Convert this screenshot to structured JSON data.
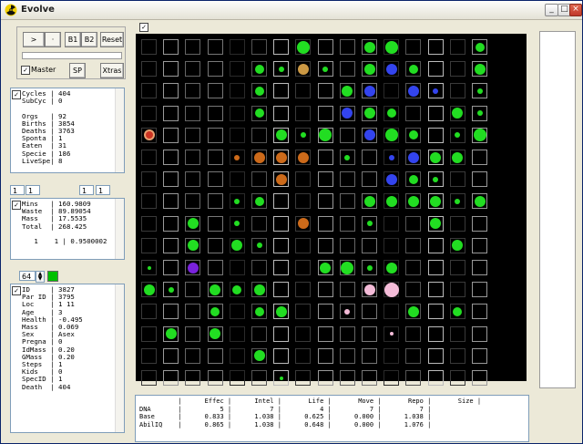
{
  "window": {
    "title": "Evolve"
  },
  "toolbar": {
    "play": ">",
    "step": "·",
    "b1": "B1",
    "b2": "B2",
    "reset": "Reset",
    "master": "Master",
    "master_checked": "✓",
    "sp": "SP",
    "xtras": "Xtras"
  },
  "grid_checkbox": "✓",
  "stats": {
    "checked": "✓",
    "lines": [
      "Cycles | 404",
      "SubCyc | 0",
      "",
      "Orgs   | 92",
      "Births | 3854",
      "Deaths | 3763",
      "Sponta | 1",
      "Eaten  | 31",
      "Specie | 186",
      "LiveSpe| 8"
    ]
  },
  "coords": {
    "x": "1",
    "y": "1",
    "x2": "1",
    "y2": "1"
  },
  "mins": {
    "checked": "✓",
    "lines": [
      "Mins   | 160.9809",
      "Waste  | 89.89054",
      "Mass   | 17.5535",
      "Total  | 268.425",
      "",
      "   1    1 | 0.9500002"
    ]
  },
  "spinner": {
    "value": "64",
    "color": "#00c000"
  },
  "organism": {
    "checked": "✓",
    "lines": [
      "ID     | 3827",
      "Par ID | 3795",
      "Loc    | 1 11",
      "Age    | 3",
      "Health | -0.495",
      "Mass   | 0.069",
      "Sex    | Asex",
      "Pregna | 0",
      "IdMass | 0.20",
      "GMass  | 0.20",
      "Steps  | 1",
      "Kids   | 0",
      "SpecID | 1",
      "Death  | 404"
    ]
  },
  "table": {
    "lines": [
      "          |      Effec |      Intel |       Life |       Move |       Repo |       Size |",
      "DNA       |          5 |          7 |          4 |          7 |          7 |",
      "Base      |      0.833 |      1.038 |      0.625 |      0.000 |      1.038 |",
      "AbilIQ    |      0.865 |      1.038 |      0.648 |      0.000 |      1.076 |"
    ]
  },
  "colors": {
    "food": "#22dd22",
    "predator": "#3344ee",
    "egg": "#cc6a1a",
    "pink": "#f4bcd8",
    "purple": "#7a22dd",
    "tan": "#cc9944",
    "red": "#cc3322"
  },
  "grid_data": {
    "cols": 16,
    "rows": 16,
    "blobs": [
      [
        7,
        0,
        "food",
        14
      ],
      [
        10,
        0,
        "food",
        12
      ],
      [
        11,
        0,
        "food",
        14
      ],
      [
        15,
        0,
        "food",
        10
      ],
      [
        5,
        1,
        "food",
        10
      ],
      [
        6,
        1,
        "food",
        6
      ],
      [
        7,
        1,
        "tan",
        12
      ],
      [
        8,
        1,
        "food",
        6
      ],
      [
        10,
        1,
        "food",
        12
      ],
      [
        11,
        1,
        "predator",
        12
      ],
      [
        12,
        1,
        "food",
        10
      ],
      [
        15,
        1,
        "food",
        12
      ],
      [
        5,
        2,
        "food",
        10
      ],
      [
        9,
        2,
        "food",
        12
      ],
      [
        10,
        2,
        "predator",
        12
      ],
      [
        12,
        2,
        "predator",
        12
      ],
      [
        13,
        2,
        "predator",
        6
      ],
      [
        15,
        2,
        "food",
        6
      ],
      [
        5,
        3,
        "food",
        10
      ],
      [
        9,
        3,
        "predator",
        12
      ],
      [
        10,
        3,
        "food",
        12
      ],
      [
        11,
        3,
        "food",
        10
      ],
      [
        14,
        3,
        "food",
        12
      ],
      [
        15,
        3,
        "food",
        6
      ],
      [
        0,
        4,
        "red",
        8
      ],
      [
        6,
        4,
        "food",
        12
      ],
      [
        7,
        4,
        "food",
        6
      ],
      [
        8,
        4,
        "food",
        14
      ],
      [
        10,
        4,
        "predator",
        12
      ],
      [
        11,
        4,
        "food",
        14
      ],
      [
        12,
        4,
        "food",
        10
      ],
      [
        14,
        4,
        "food",
        6
      ],
      [
        15,
        4,
        "food",
        14
      ],
      [
        4,
        5,
        "egg",
        6
      ],
      [
        5,
        5,
        "egg",
        12
      ],
      [
        6,
        5,
        "egg",
        12
      ],
      [
        7,
        5,
        "egg",
        12
      ],
      [
        9,
        5,
        "food",
        6
      ],
      [
        11,
        5,
        "predator",
        6
      ],
      [
        12,
        5,
        "predator",
        12
      ],
      [
        13,
        5,
        "food",
        12
      ],
      [
        14,
        5,
        "food",
        12
      ],
      [
        6,
        6,
        "egg",
        12
      ],
      [
        11,
        6,
        "predator",
        12
      ],
      [
        12,
        6,
        "food",
        10
      ],
      [
        13,
        6,
        "food",
        6
      ],
      [
        4,
        7,
        "food",
        6
      ],
      [
        5,
        7,
        "food",
        10
      ],
      [
        10,
        7,
        "food",
        12
      ],
      [
        11,
        7,
        "food",
        12
      ],
      [
        12,
        7,
        "food",
        12
      ],
      [
        13,
        7,
        "food",
        12
      ],
      [
        14,
        7,
        "food",
        6
      ],
      [
        15,
        7,
        "food",
        12
      ],
      [
        2,
        8,
        "food",
        12
      ],
      [
        4,
        8,
        "food",
        6
      ],
      [
        7,
        8,
        "egg",
        12
      ],
      [
        10,
        8,
        "food",
        6
      ],
      [
        13,
        8,
        "food",
        12
      ],
      [
        2,
        9,
        "food",
        12
      ],
      [
        4,
        9,
        "food",
        12
      ],
      [
        5,
        9,
        "food",
        6
      ],
      [
        14,
        9,
        "food",
        12
      ],
      [
        0,
        10,
        "food",
        4
      ],
      [
        2,
        10,
        "purple",
        12
      ],
      [
        8,
        10,
        "food",
        12
      ],
      [
        9,
        10,
        "food",
        14
      ],
      [
        10,
        10,
        "food",
        6
      ],
      [
        11,
        10,
        "food",
        12
      ],
      [
        0,
        11,
        "food",
        12
      ],
      [
        1,
        11,
        "food",
        6
      ],
      [
        3,
        11,
        "food",
        12
      ],
      [
        4,
        11,
        "food",
        10
      ],
      [
        5,
        11,
        "food",
        12
      ],
      [
        10,
        11,
        "pink",
        12
      ],
      [
        11,
        11,
        "pink",
        16
      ],
      [
        3,
        12,
        "food",
        10
      ],
      [
        5,
        12,
        "food",
        10
      ],
      [
        6,
        12,
        "food",
        12
      ],
      [
        9,
        12,
        "pink",
        6
      ],
      [
        12,
        12,
        "food",
        12
      ],
      [
        14,
        12,
        "food",
        10
      ],
      [
        1,
        13,
        "food",
        12
      ],
      [
        3,
        13,
        "food",
        12
      ],
      [
        11,
        13,
        "pink",
        4
      ],
      [
        5,
        14,
        "food",
        12
      ],
      [
        6,
        15,
        "food",
        4
      ]
    ]
  }
}
